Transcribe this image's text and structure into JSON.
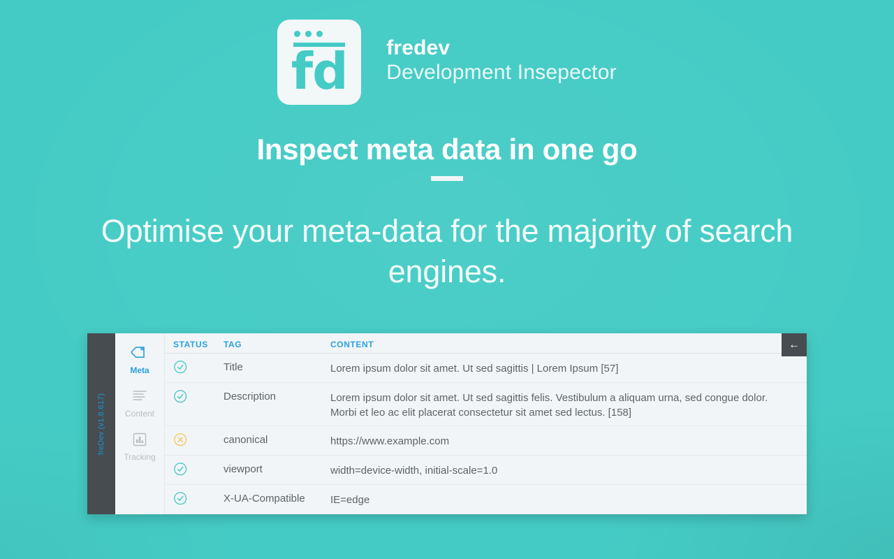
{
  "brand": {
    "logo_icon": "fd-browser-logo-icon",
    "logo_text": "fd",
    "name": "fredev",
    "subtitle": "Development Insepector"
  },
  "hero": {
    "headline": "Inspect meta data in one go",
    "subhead": "Optimise your meta-data for the majority of search engines."
  },
  "colors": {
    "background": "#45cbc5",
    "panel": "#f2f5f7",
    "sidebar_dark": "#474c51",
    "accent_blue": "#29a3e0",
    "status_ok": "#4ccbc4",
    "status_warn": "#f3c868",
    "muted": "#b7bdc2"
  },
  "panel": {
    "version_label": "freDev (v1.8.617)",
    "back_button_label": "←",
    "nav": [
      {
        "label": "Meta",
        "icon": "tag-icon",
        "active": true
      },
      {
        "label": "Content",
        "icon": "lines-icon",
        "active": false
      },
      {
        "label": "Tracking",
        "icon": "bar-chart-icon",
        "active": false
      }
    ],
    "table": {
      "headers": {
        "status": "STATUS",
        "tag": "TAG",
        "content": "CONTENT"
      },
      "rows": [
        {
          "status": "ok",
          "status_icon": "check-circle-icon",
          "tag": "Title",
          "content": "Lorem ipsum dolor sit amet. Ut sed sagittis | Lorem Ipsum [57]"
        },
        {
          "status": "ok",
          "status_icon": "check-circle-icon",
          "tag": "Description",
          "content": "Lorem ipsum dolor sit amet. Ut sed sagittis felis. Vestibulum a aliquam urna, sed congue dolor. Morbi et leo ac elit placerat consectetur sit amet sed lectus. [158]"
        },
        {
          "status": "warn",
          "status_icon": "x-circle-icon",
          "tag": "canonical",
          "content": "https://www.example.com"
        },
        {
          "status": "ok",
          "status_icon": "check-circle-icon",
          "tag": "viewport",
          "content": "width=device-width, initial-scale=1.0"
        },
        {
          "status": "ok",
          "status_icon": "check-circle-icon",
          "tag": "X-UA-Compatible",
          "content": "IE=edge"
        }
      ]
    }
  }
}
